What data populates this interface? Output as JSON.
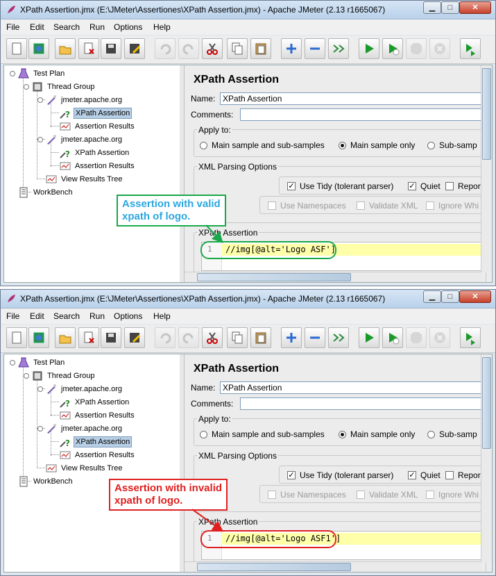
{
  "windows": [
    {
      "title": "XPath Assertion.jmx (E:\\JMeter\\Assertiones\\XPath Assertion.jmx) - Apache JMeter (2.13 r1665067)",
      "tree": [
        "Test Plan",
        "Thread Group",
        "jmeter.apache.org",
        "XPath Assertion",
        "Assertion Results",
        "jmeter.apache.org",
        "XPath Assertion",
        "Assertion Results",
        "View Results Tree",
        "WorkBench"
      ],
      "selected_index": 3,
      "xpath": "//img[@alt='Logo ASF']",
      "callout": [
        "Assertion with valid",
        "xpath of logo."
      ],
      "callout_color": "#1aa84a",
      "callout_text_color": "#2aa7e0"
    },
    {
      "title": "XPath Assertion.jmx (E:\\JMeter\\Assertiones\\XPath Assertion.jmx) - Apache JMeter (2.13 r1665067)",
      "tree": [
        "Test Plan",
        "Thread Group",
        "jmeter.apache.org",
        "XPath Assertion",
        "Assertion Results",
        "jmeter.apache.org",
        "XPath Assertion",
        "Assertion Results",
        "View Results Tree",
        "WorkBench"
      ],
      "selected_index": 6,
      "xpath": "//img[@alt='Logo ASF1']",
      "callout": [
        "Assertion with invalid",
        "xpath of logo."
      ],
      "callout_color": "#e02020",
      "callout_text_color": "#e02020"
    }
  ],
  "menu": [
    "File",
    "Edit",
    "Search",
    "Run",
    "Options",
    "Help"
  ],
  "toolbar_icons": [
    "new-icon",
    "templates-icon",
    "open-icon",
    "close-file-icon",
    "save-icon",
    "save-as-icon",
    "undo-icon",
    "redo-icon",
    "cut-icon",
    "copy-icon",
    "paste-icon",
    "expand-icon",
    "collapse-icon",
    "toggle-icon",
    "start-icon",
    "start-no-pause-icon",
    "stop-icon",
    "shutdown-icon",
    "remote-start-icon"
  ],
  "panel": {
    "heading": "XPath Assertion",
    "name_label": "Name:",
    "name_value": "XPath Assertion",
    "comments_label": "Comments:",
    "apply_to_label": "Apply to:",
    "apply_options": [
      "Main sample and sub-samples",
      "Main sample only",
      "Sub-samp"
    ],
    "apply_selected": 1,
    "xml_options_label": "XML Parsing Options",
    "use_tidy": "Use Tidy (tolerant parser)",
    "quiet": "Quiet",
    "report": "Repor",
    "use_namespaces": "Use Namespaces",
    "validate_xml": "Validate XML",
    "ignore_whitespace": "Ignore Whi",
    "xpath_label": "XPath Assertion",
    "line_number": "1"
  },
  "window_buttons": {
    "minimize": "▁",
    "maximize": "□",
    "close": "✕"
  }
}
